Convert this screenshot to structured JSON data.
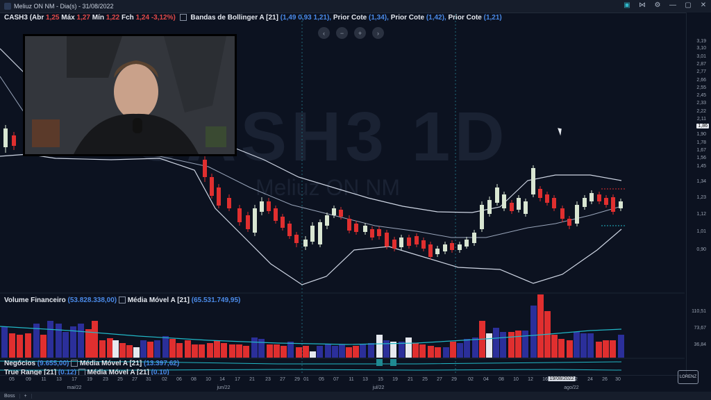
{
  "window": {
    "title": "Meliuz ON NM - Dia(s) - 31/08/2022"
  },
  "header": {
    "ticker": "CASH3",
    "ohlc_open_label": "(Abr",
    "ohlc_open": "1,25",
    "ohlc_high_label": "Máx",
    "ohlc_high": "1,27",
    "ohlc_low_label": "Mín",
    "ohlc_low": "1,22",
    "ohlc_close_label": "Fch",
    "ohlc_close": "1,24 -3,12%)",
    "bollinger_label": "Bandas de Bollinger A [21]",
    "bollinger_values": "(1,49  0,93 1,21),",
    "prior1_label": "Prior Cote",
    "prior1_value": "(1,34),",
    "prior2_label": "Prior Cote",
    "prior2_value": "(1,42),",
    "prior3_label": "Prior Cote",
    "prior3_value": "(1,21)"
  },
  "watermark": {
    "symbol": "CASH3 1D",
    "name": "Meliuz ON NM"
  },
  "volume_panel": {
    "label": "Volume Financeiro",
    "value": "(53.828.338,00)",
    "ma_label": "Média Móvel A [21]",
    "ma_value": "(65.531.749,95)"
  },
  "negocios_panel": {
    "label": "Negócios",
    "value": "(9.655,00)",
    "ma_label": "Média Móvel A [21]",
    "ma_value": "(13.397,62)"
  },
  "true_range_panel": {
    "label": "True Range [21]",
    "value": "(0.12)",
    "ma_label": "Média Móvel A [21]",
    "ma_value": "(0.10)"
  },
  "price_axis": {
    "ticks": [
      "3,19",
      "3,10",
      "3,01",
      "2,87",
      "2,77",
      "2,66",
      "2,55",
      "2,45",
      "2,33",
      "2,22",
      "2,11",
      "2,01",
      "1,90",
      "1,78",
      "1,67",
      "1,56",
      "1,45",
      "1,34",
      "1,23",
      "1,12",
      "1,01",
      "0,90"
    ],
    "current": "1,86"
  },
  "volume_axis": {
    "ticks": [
      "110,51",
      "73,67",
      "36,84"
    ]
  },
  "date_axis": {
    "days": [
      "05",
      "09",
      "11",
      "13",
      "17",
      "19",
      "23",
      "25",
      "27",
      "31",
      "02",
      "06",
      "08",
      "10",
      "14",
      "17",
      "21",
      "23",
      "27",
      "29",
      "01",
      "05",
      "07",
      "11",
      "13",
      "15",
      "19",
      "21",
      "25",
      "27",
      "29",
      "02",
      "04",
      "08",
      "10",
      "12",
      "16",
      "18",
      "22",
      "24",
      "26",
      "30"
    ],
    "months": [
      "mai/22",
      "jun/22",
      "jul/22",
      "ago/22"
    ],
    "hover_label": "19/08/2022"
  },
  "bottom_bar": {
    "tab1": "Boss",
    "add": "+"
  },
  "logo_text": "LORENZ",
  "chart_data": {
    "type": "candlestick",
    "series_count": 80,
    "y_range": [
      0.9,
      3.19
    ],
    "colors": {
      "up": "#d9e6d2",
      "down": "#e02f2f",
      "bb": "#cfd6e4",
      "ma": "#22b8c7"
    }
  }
}
